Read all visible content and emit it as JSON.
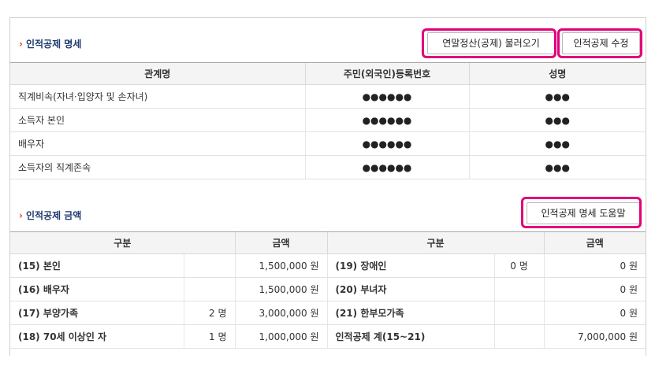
{
  "detail_section": {
    "title": "인적공제 명세",
    "load_button": "연말정산(공제) 불러오기",
    "edit_button": "인적공제 수정",
    "headers": [
      "관계명",
      "주민(외국인)등록번호",
      "성명"
    ],
    "rows": [
      {
        "relation": "직계비속(자녀·입양자 및 손자녀)",
        "id": "●●●●●●",
        "name": "●●●"
      },
      {
        "relation": "소득자 본인",
        "id": "●●●●●●",
        "name": "●●●"
      },
      {
        "relation": "배우자",
        "id": "●●●●●●",
        "name": "●●●"
      },
      {
        "relation": "소득자의 직계존속",
        "id": "●●●●●●",
        "name": "●●●"
      }
    ]
  },
  "amount_section": {
    "title": "인적공제 금액",
    "help_button": "인적공제 명세 도움말",
    "headers": [
      "구분",
      "금액",
      "구분",
      "금액"
    ],
    "rows": [
      {
        "l_label": "(15) 본인",
        "l_count": "",
        "l_amount": "1,500,000",
        "l_unit": "원",
        "r_label": "(19) 장애인",
        "r_count": "0 명",
        "r_amount": "0",
        "r_unit": "원"
      },
      {
        "l_label": "(16) 배우자",
        "l_count": "",
        "l_amount": "1,500,000",
        "l_unit": "원",
        "r_label": "(20) 부녀자",
        "r_count": "",
        "r_amount": "0",
        "r_unit": "원"
      },
      {
        "l_label": "(17) 부양가족",
        "l_count": "2 명",
        "l_amount": "3,000,000",
        "l_unit": "원",
        "r_label": "(21) 한부모가족",
        "r_count": "",
        "r_amount": "0",
        "r_unit": "원"
      },
      {
        "l_label": "(18) 70세 이상인 자",
        "l_count": "1 명",
        "l_amount": "1,000,000",
        "l_unit": "원",
        "r_label": "인적공제 계(15~21)",
        "r_count": "",
        "r_amount": "7,000,000",
        "r_unit": "원"
      }
    ]
  },
  "colors": {
    "highlight": "#e2007a",
    "title": "#1f3a70",
    "arrow": "#d84a1b",
    "header_bg": "#f4f4f4"
  }
}
